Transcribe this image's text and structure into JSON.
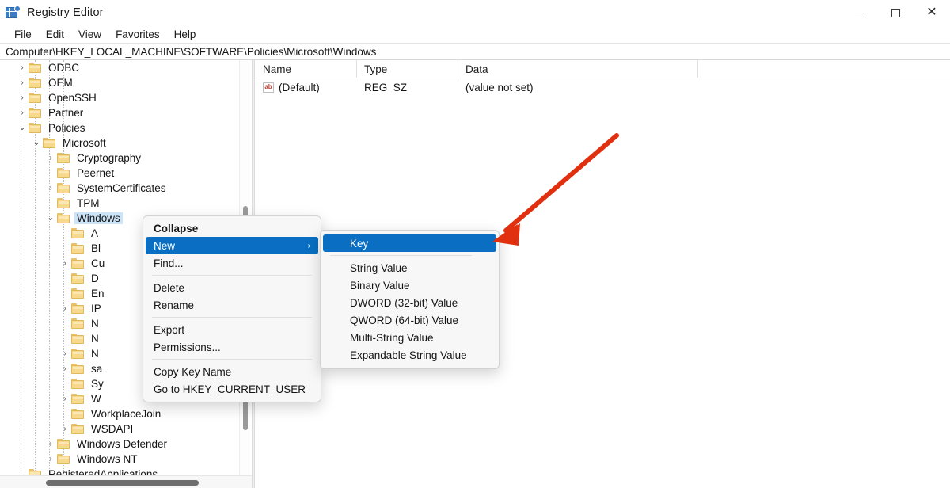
{
  "window": {
    "title": "Registry Editor",
    "icon": "registry-editor-icon",
    "controls": {
      "minimize": "─",
      "maximize": "□",
      "close": "✕"
    }
  },
  "menubar": {
    "items": [
      {
        "label": "File"
      },
      {
        "label": "Edit"
      },
      {
        "label": "View"
      },
      {
        "label": "Favorites"
      },
      {
        "label": "Help"
      }
    ]
  },
  "address": {
    "path": "Computer\\HKEY_LOCAL_MACHINE\\SOFTWARE\\Policies\\Microsoft\\Windows"
  },
  "tree": {
    "nodes": [
      {
        "label": "ODBC",
        "indent": 1,
        "chevron": "collapsed",
        "selected": false
      },
      {
        "label": "OEM",
        "indent": 1,
        "chevron": "collapsed",
        "selected": false
      },
      {
        "label": "OpenSSH",
        "indent": 1,
        "chevron": "collapsed",
        "selected": false
      },
      {
        "label": "Partner",
        "indent": 1,
        "chevron": "collapsed",
        "selected": false
      },
      {
        "label": "Policies",
        "indent": 1,
        "chevron": "expanded",
        "selected": false
      },
      {
        "label": "Microsoft",
        "indent": 2,
        "chevron": "expanded",
        "selected": false
      },
      {
        "label": "Cryptography",
        "indent": 3,
        "chevron": "collapsed",
        "selected": false
      },
      {
        "label": "Peernet",
        "indent": 3,
        "chevron": "none",
        "selected": false
      },
      {
        "label": "SystemCertificates",
        "indent": 3,
        "chevron": "collapsed",
        "selected": false
      },
      {
        "label": "TPM",
        "indent": 3,
        "chevron": "none",
        "selected": false
      },
      {
        "label": "Windows",
        "indent": 3,
        "chevron": "expanded",
        "selected": true
      },
      {
        "label": "A",
        "indent": 4,
        "chevron": "none",
        "selected": false
      },
      {
        "label": "Bl",
        "indent": 4,
        "chevron": "none",
        "selected": false
      },
      {
        "label": "Cu",
        "indent": 4,
        "chevron": "collapsed",
        "selected": false
      },
      {
        "label": "D",
        "indent": 4,
        "chevron": "none",
        "selected": false
      },
      {
        "label": "En",
        "indent": 4,
        "chevron": "none",
        "selected": false
      },
      {
        "label": "IP",
        "indent": 4,
        "chevron": "collapsed",
        "selected": false
      },
      {
        "label": "N",
        "indent": 4,
        "chevron": "none",
        "selected": false
      },
      {
        "label": "N",
        "indent": 4,
        "chevron": "none",
        "selected": false
      },
      {
        "label": "N",
        "indent": 4,
        "chevron": "collapsed",
        "selected": false
      },
      {
        "label": "sa",
        "indent": 4,
        "chevron": "collapsed",
        "selected": false
      },
      {
        "label": "Sy",
        "indent": 4,
        "chevron": "none",
        "selected": false
      },
      {
        "label": "W",
        "indent": 4,
        "chevron": "collapsed",
        "selected": false
      },
      {
        "label": "WorkplaceJoin",
        "indent": 4,
        "chevron": "none",
        "selected": false
      },
      {
        "label": "WSDAPI",
        "indent": 4,
        "chevron": "collapsed",
        "selected": false
      },
      {
        "label": "Windows Defender",
        "indent": 3,
        "chevron": "collapsed",
        "selected": false
      },
      {
        "label": "Windows NT",
        "indent": 3,
        "chevron": "collapsed",
        "selected": false
      },
      {
        "label": "RegisteredApplications",
        "indent": 1,
        "chevron": "none",
        "selected": false
      }
    ]
  },
  "list": {
    "columns": [
      "Name",
      "Type",
      "Data"
    ],
    "rows": [
      {
        "icon": "string-value-icon",
        "name": "(Default)",
        "type": "REG_SZ",
        "data": "(value not set)"
      }
    ]
  },
  "context_menu": {
    "items": [
      {
        "label": "Collapse",
        "kind": "bold"
      },
      {
        "label": "New",
        "kind": "highlight",
        "submenu_arrow": "›"
      },
      {
        "label": "Find...",
        "kind": "normal"
      },
      {
        "label": "",
        "kind": "separator"
      },
      {
        "label": "Delete",
        "kind": "normal"
      },
      {
        "label": "Rename",
        "kind": "normal"
      },
      {
        "label": "",
        "kind": "separator"
      },
      {
        "label": "Export",
        "kind": "normal"
      },
      {
        "label": "Permissions...",
        "kind": "normal"
      },
      {
        "label": "",
        "kind": "separator"
      },
      {
        "label": "Copy Key Name",
        "kind": "normal"
      },
      {
        "label": "Go to HKEY_CURRENT_USER",
        "kind": "normal"
      }
    ]
  },
  "submenu": {
    "items": [
      {
        "label": "Key",
        "kind": "highlight"
      },
      {
        "label": "",
        "kind": "separator"
      },
      {
        "label": "String Value",
        "kind": "normal"
      },
      {
        "label": "Binary Value",
        "kind": "normal"
      },
      {
        "label": "DWORD (32-bit) Value",
        "kind": "normal"
      },
      {
        "label": "QWORD (64-bit) Value",
        "kind": "normal"
      },
      {
        "label": "Multi-String Value",
        "kind": "normal"
      },
      {
        "label": "Expandable String Value",
        "kind": "normal"
      }
    ]
  },
  "annotation": {
    "arrow": "red-pointer-arrow",
    "color": "#e03010"
  },
  "colors": {
    "highlight": "#0a6fc2",
    "selection": "#cce4f7",
    "folder": "#f6d98c",
    "accent_red": "#e03010"
  }
}
